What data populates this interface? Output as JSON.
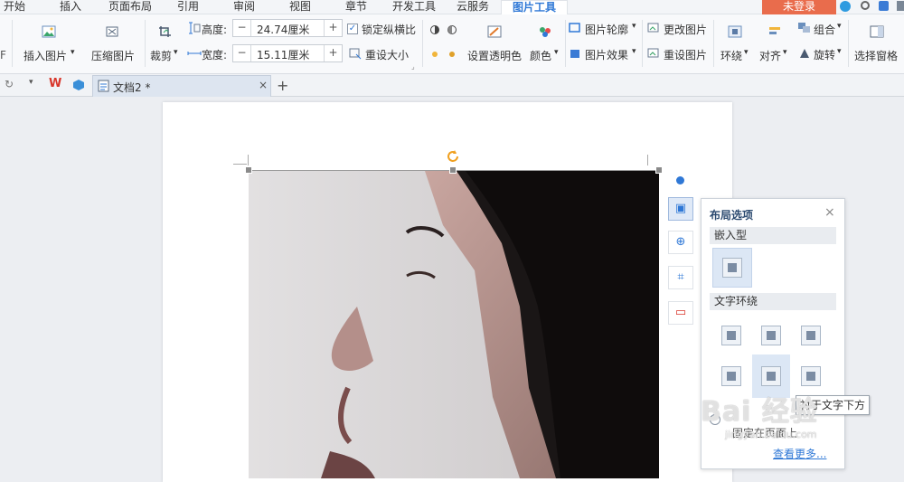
{
  "menu": {
    "tabs": [
      "开始",
      "插入",
      "页面布局",
      "引用",
      "审阅",
      "视图",
      "章节",
      "开发工具",
      "云服务",
      "图片工具"
    ],
    "login": "未登录"
  },
  "ribbon": {
    "insert_picture": "插入图片",
    "compress_picture": "压缩图片",
    "crop": "裁剪",
    "height_label": "高度:",
    "height_value": "24.74厘米",
    "width_label": "宽度:",
    "width_value": "15.11厘米",
    "lock_ratio": "锁定纵横比",
    "reset_size": "重设大小",
    "set_transparent": "设置透明色",
    "color": "颜色",
    "picture_outline": "图片轮廓",
    "picture_effect": "图片效果",
    "change_picture": "更改图片",
    "reset_picture": "重设图片",
    "wrap": "环绕",
    "align": "对齐",
    "group": "组合",
    "rotate": "旋转",
    "selection_pane": "选择窗格",
    "left_cut": "F"
  },
  "document": {
    "tab_title": "文档2 *",
    "close": "×",
    "add": "+"
  },
  "layout_panel": {
    "title": "布局选项",
    "close": "×",
    "inline_section": "嵌入型",
    "wrap_section": "文字环绕",
    "fixed_on_page": "固定在页面上",
    "see_more": "查看更多..."
  },
  "tooltip": "衬于文字下方",
  "watermark": {
    "brand": "Bai 经验",
    "url": "jingyan.baidu.com"
  },
  "colors": {
    "accent": "#2f78d6",
    "login_bg": "#e96c4c"
  }
}
